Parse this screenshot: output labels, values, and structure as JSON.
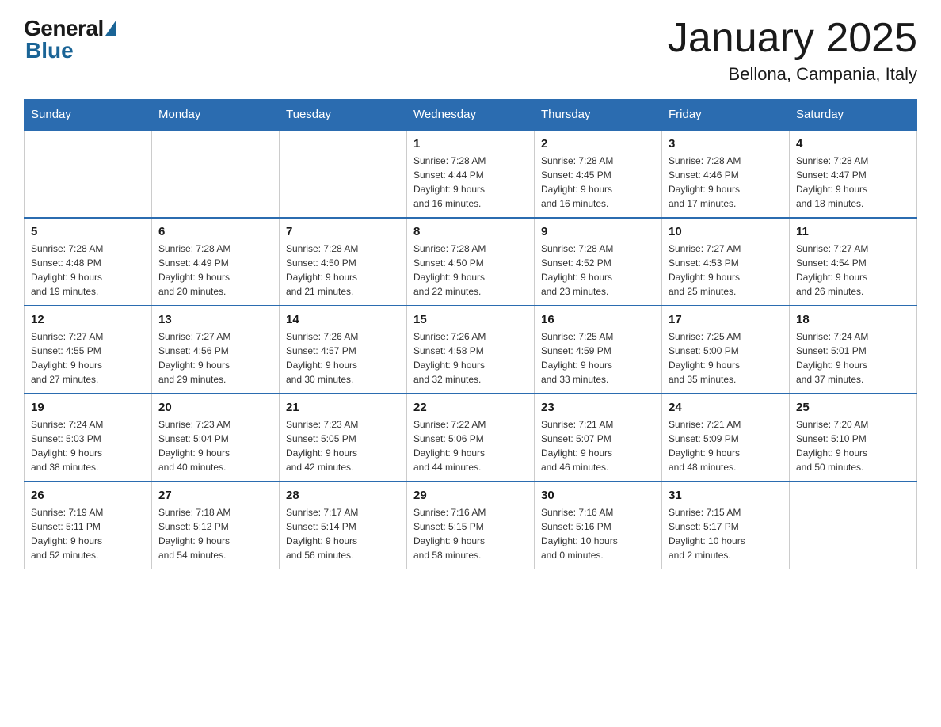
{
  "header": {
    "logo_general": "General",
    "logo_blue": "Blue",
    "title": "January 2025",
    "subtitle": "Bellona, Campania, Italy"
  },
  "days_of_week": [
    "Sunday",
    "Monday",
    "Tuesday",
    "Wednesday",
    "Thursday",
    "Friday",
    "Saturday"
  ],
  "weeks": [
    [
      {
        "day": "",
        "info": ""
      },
      {
        "day": "",
        "info": ""
      },
      {
        "day": "",
        "info": ""
      },
      {
        "day": "1",
        "info": "Sunrise: 7:28 AM\nSunset: 4:44 PM\nDaylight: 9 hours\nand 16 minutes."
      },
      {
        "day": "2",
        "info": "Sunrise: 7:28 AM\nSunset: 4:45 PM\nDaylight: 9 hours\nand 16 minutes."
      },
      {
        "day": "3",
        "info": "Sunrise: 7:28 AM\nSunset: 4:46 PM\nDaylight: 9 hours\nand 17 minutes."
      },
      {
        "day": "4",
        "info": "Sunrise: 7:28 AM\nSunset: 4:47 PM\nDaylight: 9 hours\nand 18 minutes."
      }
    ],
    [
      {
        "day": "5",
        "info": "Sunrise: 7:28 AM\nSunset: 4:48 PM\nDaylight: 9 hours\nand 19 minutes."
      },
      {
        "day": "6",
        "info": "Sunrise: 7:28 AM\nSunset: 4:49 PM\nDaylight: 9 hours\nand 20 minutes."
      },
      {
        "day": "7",
        "info": "Sunrise: 7:28 AM\nSunset: 4:50 PM\nDaylight: 9 hours\nand 21 minutes."
      },
      {
        "day": "8",
        "info": "Sunrise: 7:28 AM\nSunset: 4:50 PM\nDaylight: 9 hours\nand 22 minutes."
      },
      {
        "day": "9",
        "info": "Sunrise: 7:28 AM\nSunset: 4:52 PM\nDaylight: 9 hours\nand 23 minutes."
      },
      {
        "day": "10",
        "info": "Sunrise: 7:27 AM\nSunset: 4:53 PM\nDaylight: 9 hours\nand 25 minutes."
      },
      {
        "day": "11",
        "info": "Sunrise: 7:27 AM\nSunset: 4:54 PM\nDaylight: 9 hours\nand 26 minutes."
      }
    ],
    [
      {
        "day": "12",
        "info": "Sunrise: 7:27 AM\nSunset: 4:55 PM\nDaylight: 9 hours\nand 27 minutes."
      },
      {
        "day": "13",
        "info": "Sunrise: 7:27 AM\nSunset: 4:56 PM\nDaylight: 9 hours\nand 29 minutes."
      },
      {
        "day": "14",
        "info": "Sunrise: 7:26 AM\nSunset: 4:57 PM\nDaylight: 9 hours\nand 30 minutes."
      },
      {
        "day": "15",
        "info": "Sunrise: 7:26 AM\nSunset: 4:58 PM\nDaylight: 9 hours\nand 32 minutes."
      },
      {
        "day": "16",
        "info": "Sunrise: 7:25 AM\nSunset: 4:59 PM\nDaylight: 9 hours\nand 33 minutes."
      },
      {
        "day": "17",
        "info": "Sunrise: 7:25 AM\nSunset: 5:00 PM\nDaylight: 9 hours\nand 35 minutes."
      },
      {
        "day": "18",
        "info": "Sunrise: 7:24 AM\nSunset: 5:01 PM\nDaylight: 9 hours\nand 37 minutes."
      }
    ],
    [
      {
        "day": "19",
        "info": "Sunrise: 7:24 AM\nSunset: 5:03 PM\nDaylight: 9 hours\nand 38 minutes."
      },
      {
        "day": "20",
        "info": "Sunrise: 7:23 AM\nSunset: 5:04 PM\nDaylight: 9 hours\nand 40 minutes."
      },
      {
        "day": "21",
        "info": "Sunrise: 7:23 AM\nSunset: 5:05 PM\nDaylight: 9 hours\nand 42 minutes."
      },
      {
        "day": "22",
        "info": "Sunrise: 7:22 AM\nSunset: 5:06 PM\nDaylight: 9 hours\nand 44 minutes."
      },
      {
        "day": "23",
        "info": "Sunrise: 7:21 AM\nSunset: 5:07 PM\nDaylight: 9 hours\nand 46 minutes."
      },
      {
        "day": "24",
        "info": "Sunrise: 7:21 AM\nSunset: 5:09 PM\nDaylight: 9 hours\nand 48 minutes."
      },
      {
        "day": "25",
        "info": "Sunrise: 7:20 AM\nSunset: 5:10 PM\nDaylight: 9 hours\nand 50 minutes."
      }
    ],
    [
      {
        "day": "26",
        "info": "Sunrise: 7:19 AM\nSunset: 5:11 PM\nDaylight: 9 hours\nand 52 minutes."
      },
      {
        "day": "27",
        "info": "Sunrise: 7:18 AM\nSunset: 5:12 PM\nDaylight: 9 hours\nand 54 minutes."
      },
      {
        "day": "28",
        "info": "Sunrise: 7:17 AM\nSunset: 5:14 PM\nDaylight: 9 hours\nand 56 minutes."
      },
      {
        "day": "29",
        "info": "Sunrise: 7:16 AM\nSunset: 5:15 PM\nDaylight: 9 hours\nand 58 minutes."
      },
      {
        "day": "30",
        "info": "Sunrise: 7:16 AM\nSunset: 5:16 PM\nDaylight: 10 hours\nand 0 minutes."
      },
      {
        "day": "31",
        "info": "Sunrise: 7:15 AM\nSunset: 5:17 PM\nDaylight: 10 hours\nand 2 minutes."
      },
      {
        "day": "",
        "info": ""
      }
    ]
  ]
}
